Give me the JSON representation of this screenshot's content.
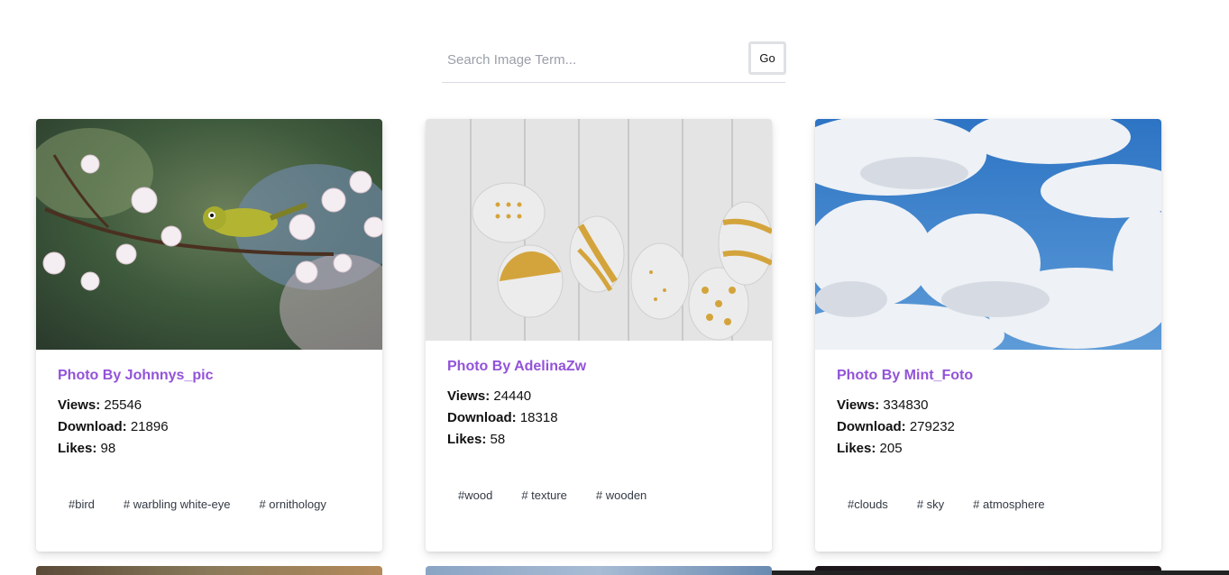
{
  "search": {
    "placeholder": "Search Image Term...",
    "go_label": "Go"
  },
  "labels": {
    "views": "Views:",
    "download": "Download:",
    "likes": "Likes:"
  },
  "cards": [
    {
      "title": "Photo By Johnnys_pic",
      "views": "25546",
      "download": "21896",
      "likes": "98",
      "tags": [
        "#bird",
        "# warbling white-eye",
        "# ornithology"
      ]
    },
    {
      "title": "Photo By AdelinaZw",
      "views": "24440",
      "download": "18318",
      "likes": "58",
      "tags": [
        "#wood",
        "# texture",
        "# wooden"
      ]
    },
    {
      "title": "Photo By Mint_Foto",
      "views": "334830",
      "download": "279232",
      "likes": "205",
      "tags": [
        "#clouds",
        "# sky",
        "# atmosphere"
      ]
    }
  ],
  "colors": {
    "accent": "#9253d9",
    "text": "#111111",
    "tag_text": "#333a44"
  }
}
